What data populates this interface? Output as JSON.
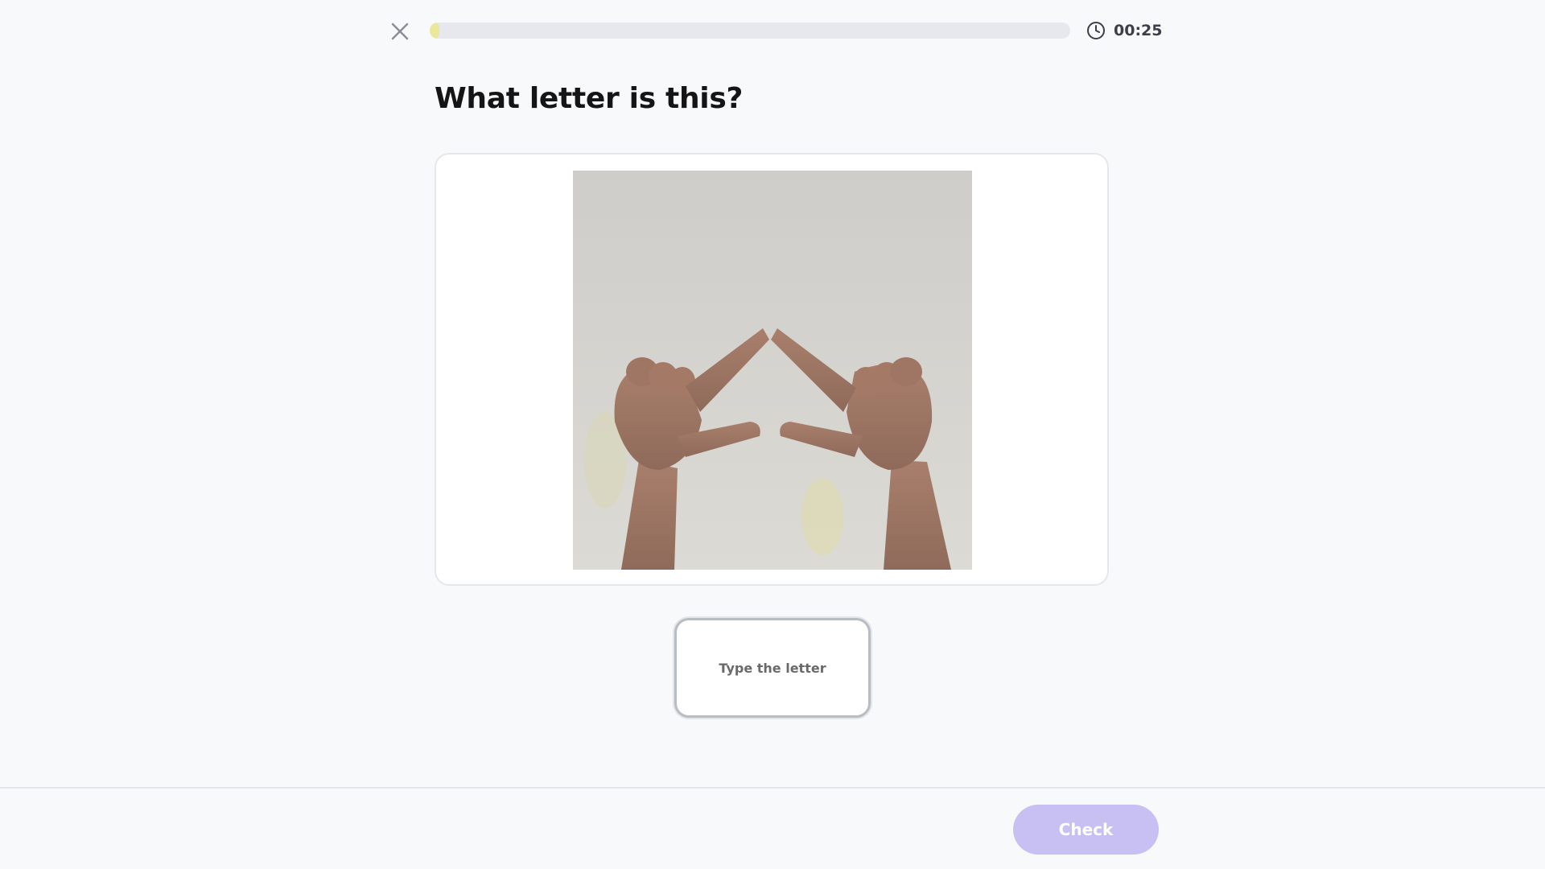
{
  "header": {
    "close_icon": "close-icon",
    "progress": 0.015,
    "progress_color": "#eae89a",
    "timer_icon": "clock-icon",
    "timer": "00:25"
  },
  "question": {
    "title": "What letter is this?"
  },
  "image": {
    "alt": "Two hands forming a sign language letter shape"
  },
  "answer": {
    "placeholder": "Type the letter",
    "value": ""
  },
  "footer": {
    "check_label": "Check",
    "check_color": "#c8c0f2"
  }
}
